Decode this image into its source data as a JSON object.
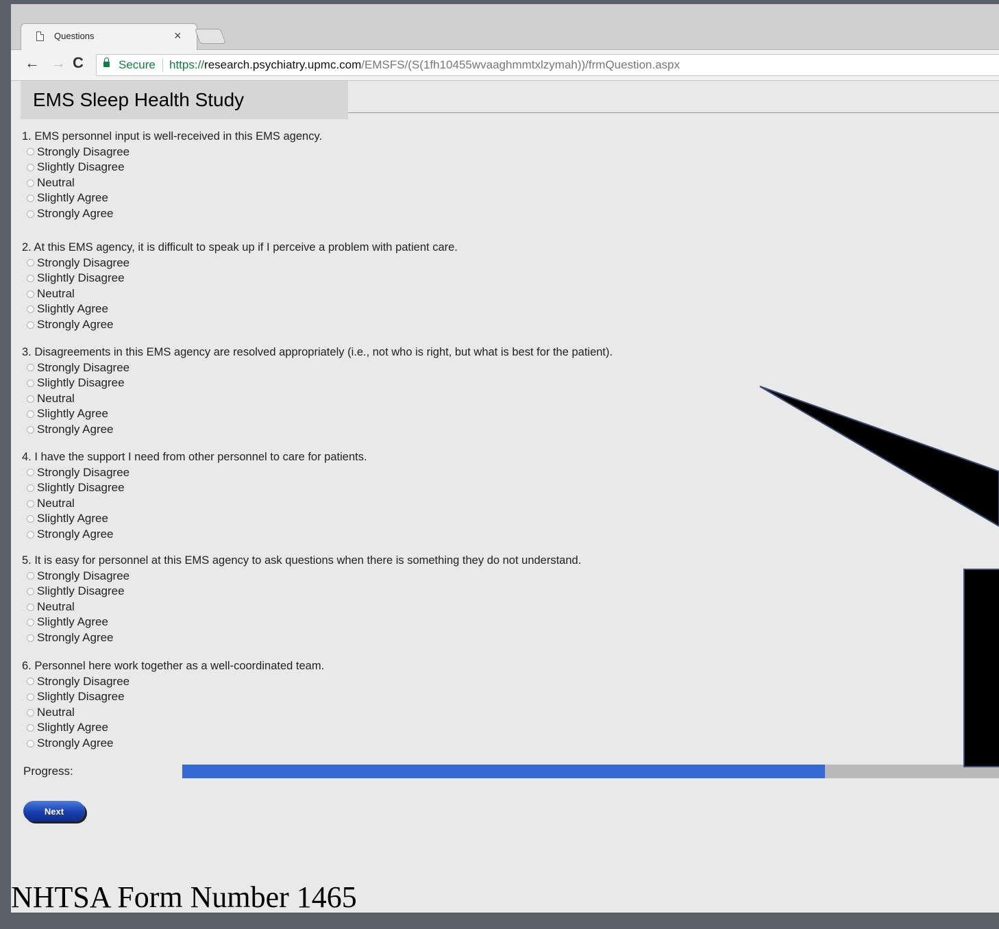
{
  "browser": {
    "tab_title": "Questions",
    "tab_close": "×",
    "back": "←",
    "forward": "→",
    "reload": "C",
    "secure_label": "Secure",
    "url_scheme": "https://",
    "url_host": "research.psychiatry.upmc.com",
    "url_path": "/EMSFS/(S(1fh10455wvaaghmmtxlzymah))/frmQuestion.aspx"
  },
  "site_title": "EMS Sleep Health Study",
  "options": [
    "Strongly Disagree",
    "Slightly Disagree",
    "Neutral",
    "Slightly Agree",
    "Strongly Agree"
  ],
  "questions": [
    "1. EMS personnel input is well-received in this EMS agency.",
    "2. At this EMS agency, it is difficult to speak up if I perceive a problem with patient care.",
    "3. Disagreements in this EMS agency are resolved appropriately (i.e., not who is right, but what is best for the patient).",
    "4. I have the support I need from other personnel to care for patients.",
    "5. It is easy for personnel at this EMS agency to ask questions when there is something they do not understand.",
    "6. Personnel here work together as a well-coordinated team."
  ],
  "progress": {
    "label": "Progress:",
    "fraction": 0.787
  },
  "next_label": "Next",
  "watermark": "NHTSA Form Number 1465",
  "colors": {
    "progress_fill": "#3569d3",
    "progress_track": "#b9b9b9",
    "secure": "#0b8043"
  }
}
